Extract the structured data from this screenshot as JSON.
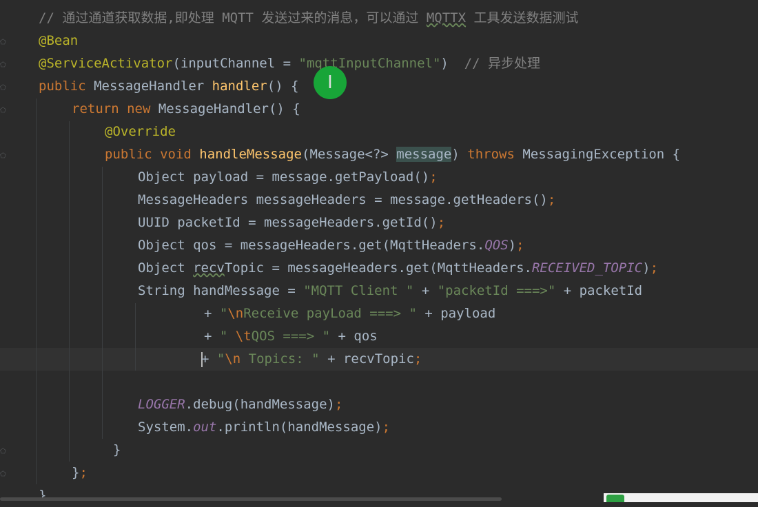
{
  "editor": {
    "lines": [
      {
        "indent": 56,
        "parts": [
          {
            "c": "cmt",
            "t": "// 通过通道获取数据,即处理 MQTT 发送过来的消息，可以通过 "
          },
          {
            "c": "cmt squig",
            "t": "MQTTX"
          },
          {
            "c": "cmt",
            "t": " 工具发送数据测试"
          }
        ]
      },
      {
        "indent": 56,
        "parts": [
          {
            "c": "ann",
            "t": "@Bean"
          }
        ]
      },
      {
        "indent": 56,
        "parts": [
          {
            "c": "ann",
            "t": "@ServiceActivator"
          },
          {
            "c": "",
            "t": "(inputChannel = "
          },
          {
            "c": "str",
            "t": "\"mqttInputChannel\""
          },
          {
            "c": "",
            "t": ")  "
          },
          {
            "c": "cmt",
            "t": "// 异步处理"
          }
        ]
      },
      {
        "indent": 56,
        "parts": [
          {
            "c": "kw",
            "t": "public "
          },
          {
            "c": "",
            "t": "MessageHandler "
          },
          {
            "c": "fn",
            "t": "handler"
          },
          {
            "c": "",
            "t": "() {"
          }
        ]
      },
      {
        "indent": 104,
        "parts": [
          {
            "c": "kw",
            "t": "return "
          },
          {
            "c": "kw",
            "t": "new "
          },
          {
            "c": "",
            "t": "MessageHandler() {"
          }
        ]
      },
      {
        "indent": 152,
        "parts": [
          {
            "c": "ann",
            "t": "@Override"
          }
        ]
      },
      {
        "indent": 152,
        "parts": [
          {
            "c": "kw",
            "t": "public void "
          },
          {
            "c": "fn",
            "t": "handleMessage"
          },
          {
            "c": "",
            "t": "(Message<?> "
          },
          {
            "c": "hl",
            "t": "message"
          },
          {
            "c": "",
            "t": ") "
          },
          {
            "c": "kw",
            "t": "throws "
          },
          {
            "c": "",
            "t": "MessagingException {"
          }
        ]
      },
      {
        "indent": 200,
        "parts": [
          {
            "c": "",
            "t": "Object payload = message.getPayload()"
          },
          {
            "c": "semi",
            "t": ";"
          }
        ]
      },
      {
        "indent": 200,
        "parts": [
          {
            "c": "",
            "t": "MessageHeaders messageHeaders = message.getHeaders()"
          },
          {
            "c": "semi",
            "t": ";"
          }
        ]
      },
      {
        "indent": 200,
        "parts": [
          {
            "c": "",
            "t": "UUID packetId = messageHeaders.getId()"
          },
          {
            "c": "semi",
            "t": ";"
          }
        ]
      },
      {
        "indent": 200,
        "parts": [
          {
            "c": "",
            "t": "Object qos = messageHeaders.get(MqttHeaders."
          },
          {
            "c": "const",
            "t": "QOS"
          },
          {
            "c": "",
            "t": ")"
          },
          {
            "c": "semi",
            "t": ";"
          }
        ]
      },
      {
        "indent": 200,
        "parts": [
          {
            "c": "",
            "t": "Object "
          },
          {
            "c": "squig",
            "t": "recv"
          },
          {
            "c": "",
            "t": "Topic = messageHeaders.get(MqttHeaders."
          },
          {
            "c": "const",
            "t": "RECEIVED_TOPIC"
          },
          {
            "c": "",
            "t": ")"
          },
          {
            "c": "semi",
            "t": ";"
          }
        ]
      },
      {
        "indent": 200,
        "parts": [
          {
            "c": "",
            "t": "String handMessage = "
          },
          {
            "c": "str",
            "t": "\"MQTT Client \""
          },
          {
            "c": "",
            "t": " + "
          },
          {
            "c": "str",
            "t": "\"packetId ===>\""
          },
          {
            "c": "",
            "t": " + packetId"
          }
        ]
      },
      {
        "indent": 296,
        "parts": [
          {
            "c": "",
            "t": "+ "
          },
          {
            "c": "str",
            "t": "\""
          },
          {
            "c": "esc",
            "t": "\\n"
          },
          {
            "c": "str",
            "t": "Receive payLoad ===> \""
          },
          {
            "c": "",
            "t": " + payload"
          }
        ]
      },
      {
        "indent": 296,
        "parts": [
          {
            "c": "",
            "t": "+ "
          },
          {
            "c": "str",
            "t": "\" "
          },
          {
            "c": "esc",
            "t": "\\t"
          },
          {
            "c": "str",
            "t": "QOS ===> \""
          },
          {
            "c": "",
            "t": " + qos"
          }
        ]
      },
      {
        "indent": 292,
        "caret": true,
        "current": true,
        "parts": [
          {
            "c": "",
            "t": "+ "
          },
          {
            "c": "str",
            "t": "\""
          },
          {
            "c": "esc",
            "t": "\\n"
          },
          {
            "c": "str",
            "t": " Topics: \""
          },
          {
            "c": "",
            "t": " + recvTopic"
          },
          {
            "c": "semi",
            "t": ";"
          }
        ]
      },
      {
        "indent": 200,
        "parts": []
      },
      {
        "indent": 200,
        "parts": [
          {
            "c": "const",
            "t": "LOGGER"
          },
          {
            "c": "",
            "t": ".debug(handMessage)"
          },
          {
            "c": "semi",
            "t": ";"
          }
        ]
      },
      {
        "indent": 200,
        "parts": [
          {
            "c": "",
            "t": "System."
          },
          {
            "c": "const",
            "t": "out"
          },
          {
            "c": "",
            "t": ".println(handMessage)"
          },
          {
            "c": "semi",
            "t": ";"
          }
        ]
      },
      {
        "indent": 164,
        "parts": [
          {
            "c": "",
            "t": "}"
          }
        ]
      },
      {
        "indent": 104,
        "parts": [
          {
            "c": "",
            "t": "}"
          },
          {
            "c": "semi",
            "t": ";"
          }
        ]
      },
      {
        "indent": 56,
        "parts": [
          {
            "c": "",
            "t": "}"
          }
        ]
      }
    ]
  },
  "cursor": {
    "glyph": "I"
  }
}
